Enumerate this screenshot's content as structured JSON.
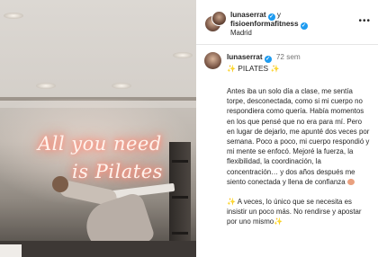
{
  "photo": {
    "neon_line1": "All you need",
    "neon_line2": "is Pilates"
  },
  "header": {
    "user1": "lunaserrat",
    "conjunction": "y",
    "user2": "fisioenformafitness",
    "location": "Madrid",
    "more_icon": "more-dots-icon",
    "verified_icon": "verified-badge-icon"
  },
  "caption": {
    "username": "lunaserrat",
    "time": "72 sem",
    "title": "PILATES",
    "sparkle_icon": "sparkles-icon",
    "paragraph1": "Antes iba un solo día a clase, me sentía torpe, desconectada, como si mi cuerpo no respondiera como quería. Había momentos en los que pensé que no era para mí. Pero en lugar de dejarlo, me apunté dos veces por semana. Poco a poco, mi cuerpo respondió y mi mente se enfocó. Mejoré la fuerza, la flexibilidad, la coordinación, la concentración… y dos años después me siento conectada y llena de confianza",
    "paragraph2": "A veces, lo único que se necesita es insistir un poco más. No rendirse y apostar por uno mismo"
  },
  "colors": {
    "verified": "#1d9bf0",
    "text": "#262626",
    "muted": "#737373",
    "neon_glow": "#ff7a66"
  }
}
